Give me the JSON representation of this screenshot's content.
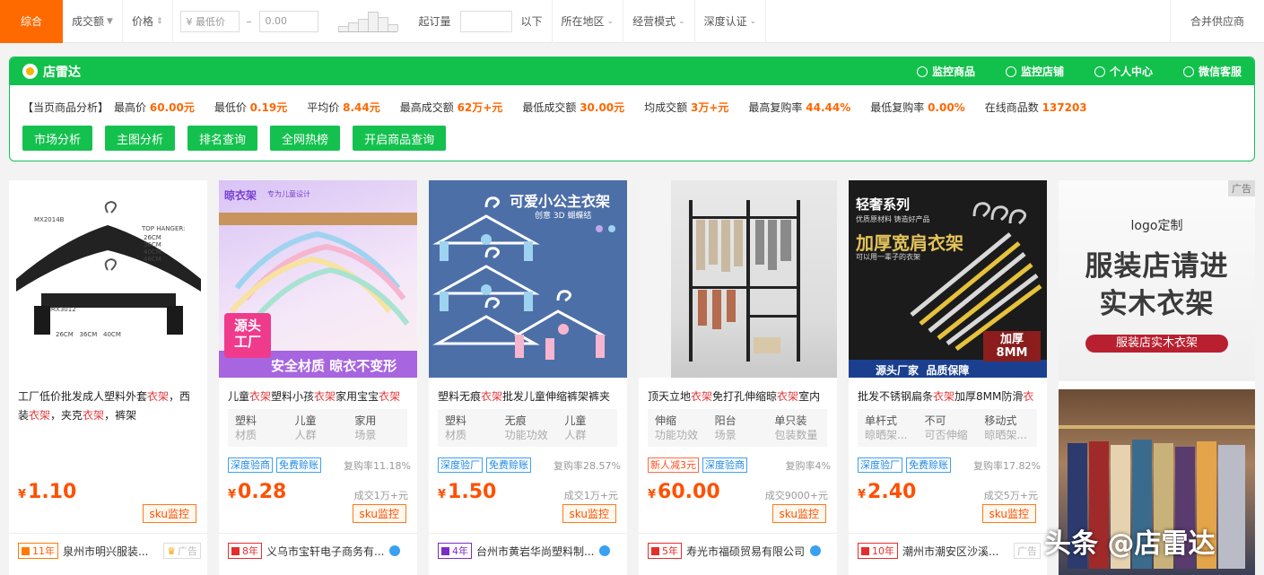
{
  "filters": {
    "sort_active": "综合",
    "sort_volume": "成交额",
    "sort_price": "价格",
    "min_price_placeholder": "¥ 最低价",
    "dash": "–",
    "max_price_placeholder": "0.00",
    "moq_label": "起订量",
    "moq_suffix": "以下",
    "region": "所在地区",
    "business_mode": "经营模式",
    "certification": "深度认证",
    "merge_suppliers": "合并供应商"
  },
  "plugin": {
    "brand": "店雷达",
    "links": [
      "监控商品",
      "监控店铺",
      "个人中心",
      "微信客服"
    ],
    "stats_label": "【当页商品分析】",
    "stats": [
      {
        "label": "最高价",
        "value": "60.00元"
      },
      {
        "label": "最低价",
        "value": "0.19元"
      },
      {
        "label": "平均价",
        "value": "8.44元"
      },
      {
        "label": "最高成交额",
        "value": "62万+元"
      },
      {
        "label": "最低成交额",
        "value": "30.00元"
      },
      {
        "label": "均成交额",
        "value": "3万+元"
      },
      {
        "label": "最高复购率",
        "value": "44.44%"
      },
      {
        "label": "最低复购率",
        "value": "0.00%"
      },
      {
        "label": "在线商品数",
        "value": "137203"
      }
    ],
    "tools": [
      "市场分析",
      "主图分析",
      "排名查询",
      "全网热榜",
      "开启商品查询"
    ]
  },
  "products": [
    {
      "title_parts": [
        "工厂低价批发成人塑料外套",
        "衣架",
        "，西装",
        "衣架",
        "，夹克",
        "衣架",
        "，裤架"
      ],
      "attrs": [],
      "tags": [],
      "repurchase": "",
      "price_symbol": "¥",
      "price": "1.10",
      "sold": "",
      "sku": "sku监控",
      "years": "11年",
      "seller": "泉州市明兴服装...",
      "ad": "广告",
      "image_text": {
        "top_hanger": "TOP HANGER:",
        "sizes": "26CM\n36CM\n40CM\n46CM",
        "model1": "MX2014B",
        "model2": "MX3012",
        "bottom_sizes": "26CM   36CM   40CM"
      }
    },
    {
      "title_parts": [
        "儿童",
        "衣架",
        "塑料小孩",
        "衣架",
        "家用宝宝",
        "衣架"
      ],
      "attrs": [
        {
          "v": "塑料",
          "k": "材质"
        },
        {
          "v": "儿童",
          "k": "人群"
        },
        {
          "v": "家用",
          "k": "场景"
        }
      ],
      "tags": [
        {
          "text": "深度验商",
          "type": "blue"
        },
        {
          "text": "免费赊账",
          "type": "blue"
        }
      ],
      "repurchase": "复购率11.18%",
      "price_symbol": "¥",
      "price": "0.28",
      "sold": "成交1万+元",
      "sku": "sku监控",
      "years": "8年",
      "seller": "义乌市宝轩电子商务有...",
      "ad": "",
      "image_text": {
        "brand": "晾衣架",
        "sub": "专为儿童设计",
        "badge": "源头\n工厂",
        "banner": "安全材质 晾衣不变形"
      }
    },
    {
      "title_parts": [
        "塑料无痕",
        "衣架",
        "批发儿童伸缩裤架裤夹"
      ],
      "attrs": [
        {
          "v": "塑料",
          "k": "材质"
        },
        {
          "v": "无痕",
          "k": "功能功效"
        },
        {
          "v": "儿童",
          "k": "人群"
        }
      ],
      "tags": [
        {
          "text": "深度验厂",
          "type": "blue"
        },
        {
          "text": "免费赊账",
          "type": "blue"
        }
      ],
      "repurchase": "复购率28.57%",
      "price_symbol": "¥",
      "price": "1.50",
      "sold": "成交1万+元",
      "sku": "sku监控",
      "years": "4年",
      "seller": "台州市黄岩华尚塑料制...",
      "ad": "",
      "image_text": {
        "headline": "可爱小公主衣架",
        "sub": "创意 3D 蝴蝶结"
      }
    },
    {
      "title_parts": [
        "顶天立地",
        "衣架",
        "免打孔伸缩晾",
        "衣架",
        "室内"
      ],
      "attrs": [
        {
          "v": "伸缩",
          "k": "功能功效"
        },
        {
          "v": "阳台",
          "k": "场景"
        },
        {
          "v": "单只装",
          "k": "包装数量"
        }
      ],
      "tags": [
        {
          "text": "新人减3元",
          "type": "red"
        },
        {
          "text": "深度验商",
          "type": "blue"
        }
      ],
      "repurchase": "复购率4%",
      "price_symbol": "¥",
      "price": "60.00",
      "sold": "成交9000+元",
      "sku": "sku监控",
      "years": "5年",
      "seller": "寿光市福硕贸易有限公司",
      "ad": "",
      "image_text": {}
    },
    {
      "title_parts": [
        "批发不锈钢扁条",
        "衣架",
        "加厚8MM防滑",
        "衣"
      ],
      "attrs": [
        {
          "v": "单杆式",
          "k": "晾晒架..."
        },
        {
          "v": "不可",
          "k": "可否伸缩"
        },
        {
          "v": "移动式",
          "k": "晾晒架..."
        }
      ],
      "tags": [
        {
          "text": "深度验厂",
          "type": "blue"
        },
        {
          "text": "免费赊账",
          "type": "blue"
        }
      ],
      "repurchase": "复购率17.82%",
      "price_symbol": "¥",
      "price": "2.40",
      "sold": "成交5万+元",
      "sku": "sku监控",
      "years": "10年",
      "seller": "潮州市潮安区沙溪...",
      "ad": "广告",
      "image_text": {
        "series": "轻奢系列",
        "sub": "优质原材料 铸造好产品",
        "headline": "加厚宽肩衣架",
        "tagline": "可以用一辈子的衣架",
        "thick": "加厚\n8MM",
        "footer": "源头厂家  品质保障"
      }
    }
  ],
  "sidebar_ad": {
    "tag": "广告",
    "logo": "logo定制",
    "line1": "服装店请进",
    "line2": "实木衣架",
    "pill": "服装店实木衣架"
  },
  "watermark": "头条 @店雷达",
  "colors": {
    "accent": "#ff6a00",
    "green": "#12c04c",
    "price": "#ff5000",
    "highlight": "#e4393c"
  }
}
